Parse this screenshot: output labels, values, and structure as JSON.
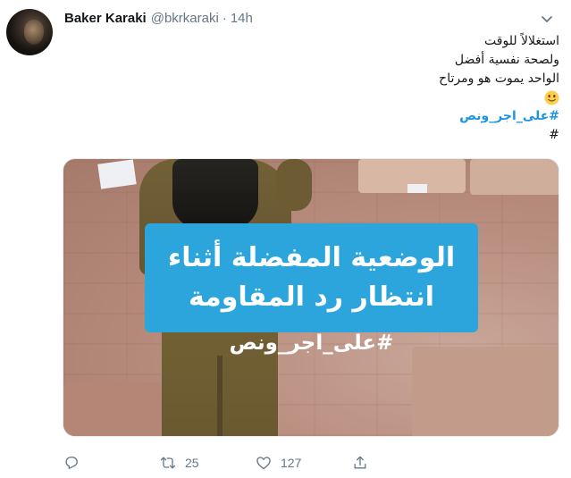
{
  "tweet": {
    "author": {
      "display_name": "Baker Karaki",
      "handle": "@bkrkaraki"
    },
    "separator": "·",
    "time": "14h",
    "text_lines": [
      "استغلالاً للوقت",
      "ولصحة نفسية أفضل",
      "الواحد يموت هو ومرتاح"
    ],
    "emoji": "slightly-smiling-face-icon",
    "hashtag": "#على_اجر_ونص",
    "trailing_hash": "#",
    "media": {
      "banner_lines": [
        "الوضعية المفضلة أثناء",
        "انتظار رد المقاومة"
      ],
      "hashtag": "#على_اجر_ونص"
    },
    "actions": {
      "reply_count": "",
      "retweet_count": "25",
      "like_count": "127"
    }
  },
  "colors": {
    "link": "#1b95e0",
    "muted": "#657786",
    "banner": "#2ca4dc"
  }
}
